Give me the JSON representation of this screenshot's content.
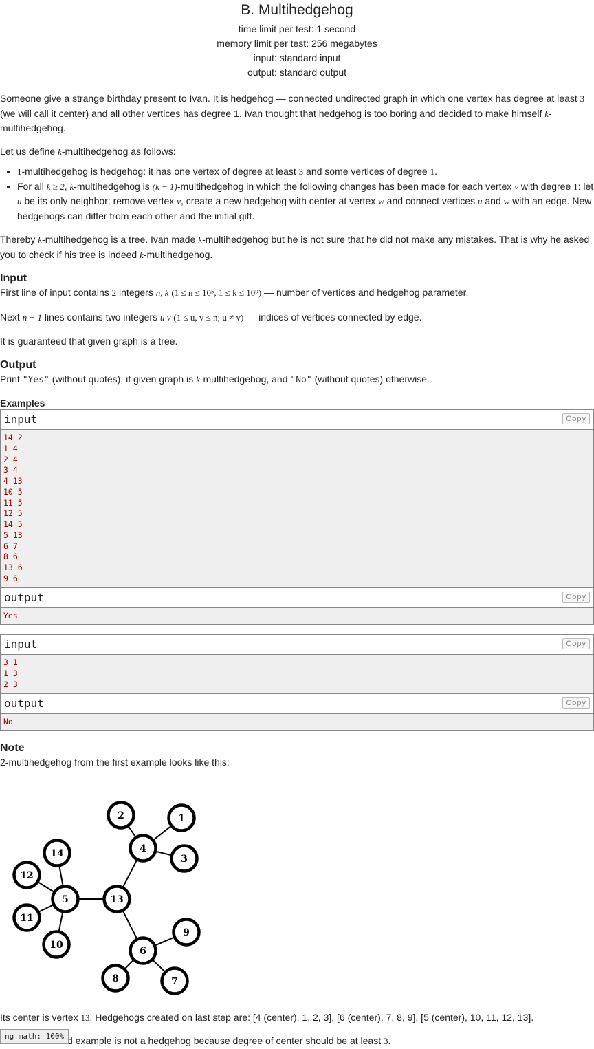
{
  "title": "B. Multihedgehog",
  "meta": {
    "time": "time limit per test: 1 second",
    "memory": "memory limit per test: 256 megabytes",
    "input": "input: standard input",
    "output": "output: standard output"
  },
  "statement": {
    "p1a": "Someone give a strange birthday present to Ivan. It is hedgehog — connected undirected graph in which one vertex has degree at least ",
    "p1b": " (we will call it center) and all other vertices has degree 1. Ivan thought that hedgehog is too boring and decided to make himself ",
    "p1c": "-multihedgehog.",
    "p2a": "Let us define ",
    "p2b": "-multihedgehog as follows:",
    "li1a": "-multihedgehog is hedgehog: it has one vertex of degree at least ",
    "li1b": " and some vertices of degree ",
    "li2a": "For all ",
    "li2b": "-multihedgehog is ",
    "li2c": "-multihedgehog in which the following changes has been made for each vertex ",
    "li2d": " with degree ",
    "li2e": ": let ",
    "li2f": " be its only neighbor; remove vertex ",
    "li2g": ", create a new hedgehog with center at vertex ",
    "li2h": " and connect vertices ",
    "li2i": " and ",
    "li2j": " with an edge. New hedgehogs can differ from each other and the initial gift.",
    "p3a": "Thereby ",
    "p3b": "-multihedgehog is a tree. Ivan made ",
    "p3c": "-multihedgehog but he is not sure that he did not make any mistakes. That is why he asked you to check if his tree is indeed ",
    "p3d": "-multihedgehog."
  },
  "input_section": {
    "heading": "Input",
    "l1a": "First line of input contains ",
    "l1b": " integers ",
    "l1c": " — number of vertices and hedgehog parameter.",
    "l2a": "Next ",
    "l2b": " lines contains two integers ",
    "l2c": " — indices of vertices connected by edge.",
    "l3": "It is guaranteed that given graph is a tree."
  },
  "output_section": {
    "heading": "Output",
    "a": "Print ",
    "yes": "\"Yes\"",
    "b": " (without quotes), if given graph is ",
    "c": "-multihedgehog, and ",
    "no": "\"No\"",
    "d": " (without quotes) otherwise."
  },
  "examples": {
    "heading": "Examples",
    "input_label": "input",
    "output_label": "output",
    "copy_label": "Copy",
    "ex1_input": "14 2\n1 4\n2 4\n3 4\n4 13\n10 5\n11 5\n12 5\n14 5\n5 13\n6 7\n8 6\n13 6\n9 6",
    "ex1_output": "Yes",
    "ex2_input": "3 1\n1 3\n2 3",
    "ex2_output": "No"
  },
  "note": {
    "heading": "Note",
    "intro": "2-multihedgehog from the first example looks like this:",
    "center_a": "Its center is vertex ",
    "center_b": ". Hedgehogs created on last step are: [4 (center), 1, 2, 3], [6 (center), 7, 8, 9], [5 (center), 10, 11, 12, 13].",
    "second_a": "d example is not a hedgehog because degree of center should be at least ",
    "second_b": "."
  },
  "math": {
    "three": "3",
    "k": "k",
    "one": "1",
    "k_ge_2": "k ≥ 2",
    "k_minus_1": "(k − 1)",
    "v": "v",
    "u": "u",
    "w": "w",
    "two": "2",
    "n_k": "n, k",
    "constraints": "(1 ≤ n ≤ 10⁵, 1 ≤ k ≤ 10⁹)",
    "n_minus_1": "n − 1",
    "u_v": "u v",
    "uv_constraints": "(1 ≤ u,  v ≤ n;  u ≠ v)",
    "thirteen": "13"
  },
  "graph": {
    "nodes": [
      "1",
      "2",
      "3",
      "4",
      "5",
      "6",
      "7",
      "8",
      "9",
      "10",
      "11",
      "12",
      "13",
      "14"
    ],
    "edges": [
      [
        "4",
        "1"
      ],
      [
        "4",
        "2"
      ],
      [
        "4",
        "3"
      ],
      [
        "4",
        "13"
      ],
      [
        "5",
        "10"
      ],
      [
        "5",
        "11"
      ],
      [
        "5",
        "12"
      ],
      [
        "5",
        "14"
      ],
      [
        "5",
        "13"
      ],
      [
        "6",
        "7"
      ],
      [
        "6",
        "8"
      ],
      [
        "6",
        "13"
      ],
      [
        "6",
        "9"
      ]
    ]
  },
  "zoom_label": "ng math: 100%"
}
